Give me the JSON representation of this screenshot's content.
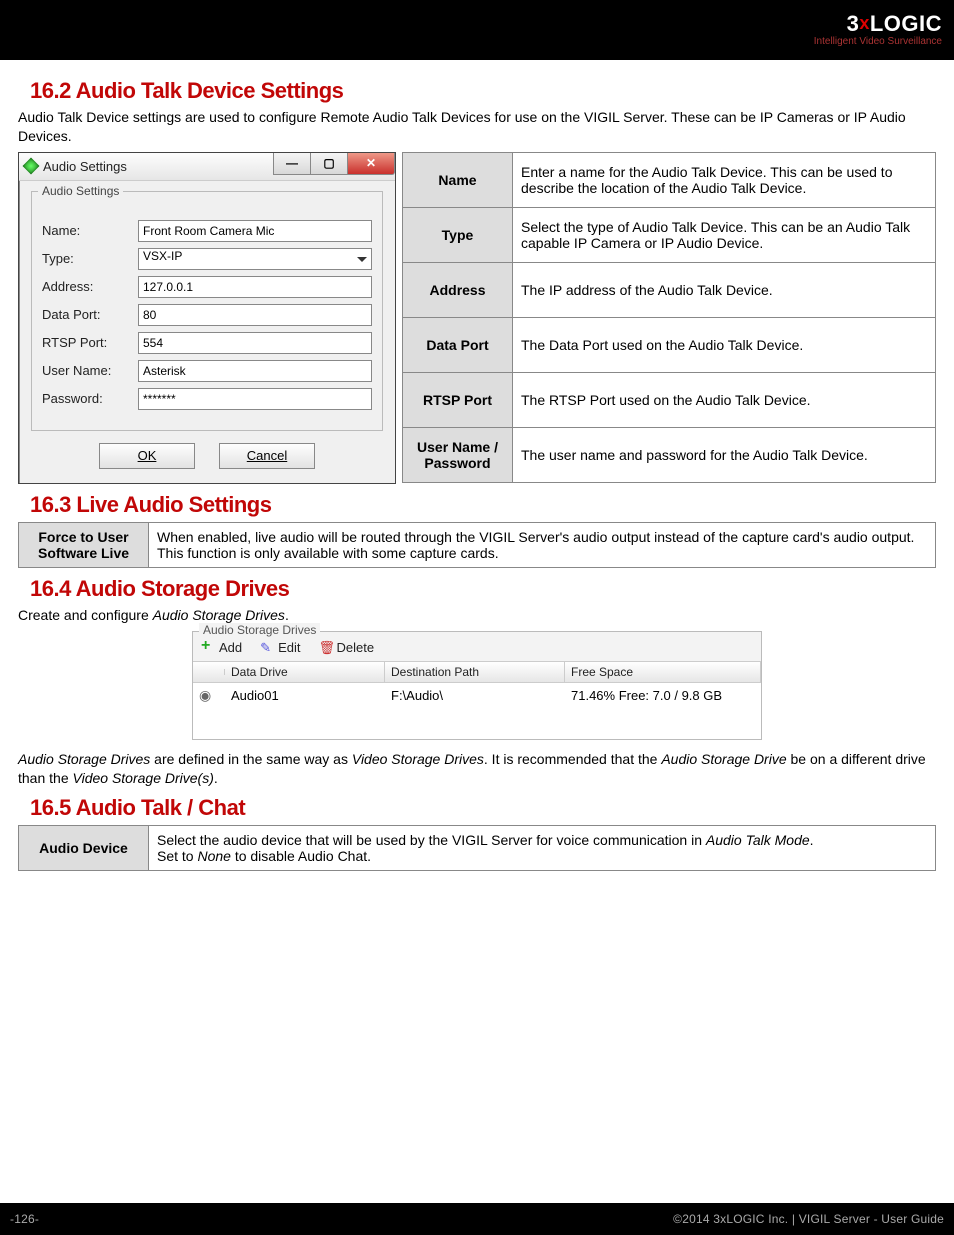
{
  "header": {
    "logo_main_pre": "3",
    "logo_main_mid": "x",
    "logo_main_post": "LOGIC",
    "logo_sub": "Intelligent Video Surveillance"
  },
  "s162": {
    "heading": "16.2  Audio Talk Device Settings",
    "intro": "Audio Talk Device settings are used to configure Remote Audio Talk Devices for use on the VIGIL Server.  These can be IP Cameras or IP Audio Devices.",
    "dialog": {
      "title": "Audio Settings",
      "group": "Audio Settings",
      "labels": {
        "name": "Name:",
        "type": "Type:",
        "address": "Address:",
        "dataport": "Data Port:",
        "rtspport": "RTSP Port:",
        "username": "User Name:",
        "password": "Password:"
      },
      "values": {
        "name": "Front Room Camera Mic",
        "type": "VSX-IP",
        "address": "127.0.0.1",
        "dataport": "80",
        "rtspport": "554",
        "username": "Asterisk",
        "password": "*******"
      },
      "btn_ok": "OK",
      "btn_cancel": "Cancel"
    },
    "defs": [
      {
        "term": "Name",
        "desc": "Enter a name for the Audio Talk Device. This can be used to describe the location of the Audio Talk Device."
      },
      {
        "term": "Type",
        "desc": "Select the type of Audio Talk Device.  This can be an Audio Talk capable IP Camera or IP Audio Device."
      },
      {
        "term": "Address",
        "desc": "The IP address of the Audio Talk Device."
      },
      {
        "term": "Data Port",
        "desc": "The Data Port used on the Audio Talk Device."
      },
      {
        "term": "RTSP Port",
        "desc": "The RTSP Port used on the Audio Talk Device."
      },
      {
        "term": "User Name / Password",
        "desc": "The user name and password for the Audio Talk Device."
      }
    ]
  },
  "s163": {
    "heading": "16.3 Live Audio Settings",
    "defs": [
      {
        "term": "Force to User Software Live",
        "desc": "When enabled, live audio will be routed through the VIGIL Server's audio output instead of the capture card's audio output.   This function is only available with some capture cards."
      }
    ]
  },
  "s164": {
    "heading": "16.4 Audio Storage Drives",
    "intro_pre": "Create and configure ",
    "intro_it": "Audio Storage Drives",
    "intro_post": ".",
    "panel": {
      "group": "Audio Storage Drives",
      "btn_add": "Add",
      "btn_edit": "Edit",
      "btn_del": "Delete",
      "cols": {
        "c1": "",
        "c2": "Data Drive",
        "c3": "Destination Path",
        "c4": "Free Space"
      },
      "row": {
        "drive": "Audio01",
        "path": "F:\\Audio\\",
        "free": "71.46% Free: 7.0 / 9.8 GB"
      }
    },
    "outro_1a": "Audio Storage Drives",
    "outro_1b": " are defined in the same way as ",
    "outro_1c": "Video Storage Drives",
    "outro_1d": ". It is recommended that the ",
    "outro_1e": "Audio Storage Drive",
    "outro_1f": " be on a different drive than the ",
    "outro_1g": "Video Storage Drive(s)",
    "outro_1h": "."
  },
  "s165": {
    "heading": "16.5 Audio Talk / Chat",
    "defs": [
      {
        "term": "Audio Device",
        "desc_a": "Select the audio device that will be used by the VIGIL Server for voice communication in ",
        "desc_it": "Audio Talk Mode",
        "desc_b": ".",
        "desc_c": "Set to ",
        "desc_it2": "None",
        "desc_d": " to disable Audio Chat."
      }
    ]
  },
  "footer": {
    "left": "-126-",
    "right": "©2014 3xLOGIC Inc.  |  VIGIL Server - User Guide"
  }
}
